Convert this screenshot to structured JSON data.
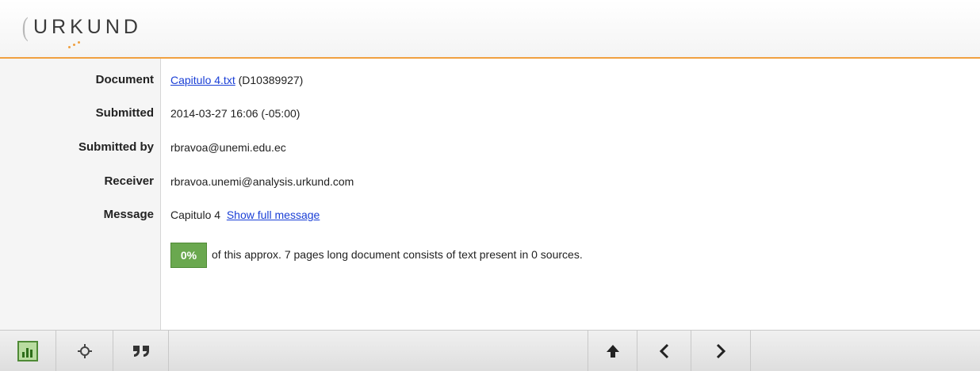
{
  "brand": {
    "logo_text": "URKUND"
  },
  "fields": {
    "document_label": "Document",
    "document_link": "Capitulo 4.txt",
    "document_id": "(D10389927)",
    "submitted_label": "Submitted",
    "submitted_value": "2014-03-27 16:06 (-05:00)",
    "submitted_by_label": "Submitted by",
    "submitted_by_value": "rbravoa@unemi.edu.ec",
    "receiver_label": "Receiver",
    "receiver_value": "rbravoa.unemi@analysis.urkund.com",
    "message_label": "Message",
    "message_value": "Capitulo 4",
    "message_link": "Show full message"
  },
  "score": {
    "badge": "0%",
    "text": "of this approx. 7 pages long document consists of text present in 0 sources.",
    "color": "#6aa84f"
  },
  "toolbar": {
    "icons": [
      "chart-icon",
      "crosshair-icon",
      "quote-icon",
      "arrow-up-icon",
      "chevron-left-icon",
      "chevron-right-icon"
    ]
  },
  "colors": {
    "accent": "#f0a040",
    "link": "#1a3fd6"
  }
}
